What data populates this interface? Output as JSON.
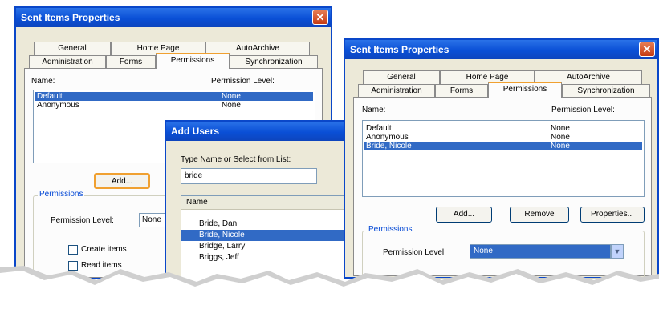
{
  "window1": {
    "title": "Sent Items Properties",
    "tabs_back": [
      "General",
      "Home Page",
      "AutoArchive"
    ],
    "tabs_front": [
      "Administration",
      "Forms",
      "Permissions",
      "Synchronization"
    ],
    "name_header": "Name:",
    "perm_header": "Permission Level:",
    "users": [
      {
        "name": "Default",
        "level": "None"
      },
      {
        "name": "Anonymous",
        "level": "None"
      }
    ],
    "add_button": "Add...",
    "permissions_group": "Permissions",
    "perm_level_label": "Permission Level:",
    "perm_level_value": "None",
    "create_items": "Create items",
    "read_items": "Read items"
  },
  "adduser": {
    "title": "Add Users",
    "prompt": "Type Name or Select from List:",
    "search_value": "bride",
    "col_header": "Name",
    "names": [
      "Bride, Dan",
      "Bride, Nicole",
      "Bridge, Larry",
      "Briggs, Jeff"
    ]
  },
  "window2": {
    "title": "Sent Items Properties",
    "tabs_back": [
      "General",
      "Home Page",
      "AutoArchive"
    ],
    "tabs_front": [
      "Administration",
      "Forms",
      "Permissions",
      "Synchronization"
    ],
    "name_header": "Name:",
    "perm_header": "Permission Level:",
    "users": [
      {
        "name": "Default",
        "level": "None"
      },
      {
        "name": "Anonymous",
        "level": "None"
      },
      {
        "name": "Bride, Nicole",
        "level": "None"
      }
    ],
    "add_button": "Add...",
    "remove_button": "Remove",
    "properties_button": "Properties...",
    "permissions_group": "Permissions",
    "perm_level_label": "Permission Level:",
    "perm_level_value": "None"
  },
  "icons": {
    "close": "close-icon",
    "dropdown": "dropdown-arrow-icon"
  },
  "colors": {
    "title_blue": "#0a4fd6",
    "selection": "#316ac5",
    "close_red": "#c53b13",
    "tab_accent": "#f0a030"
  }
}
